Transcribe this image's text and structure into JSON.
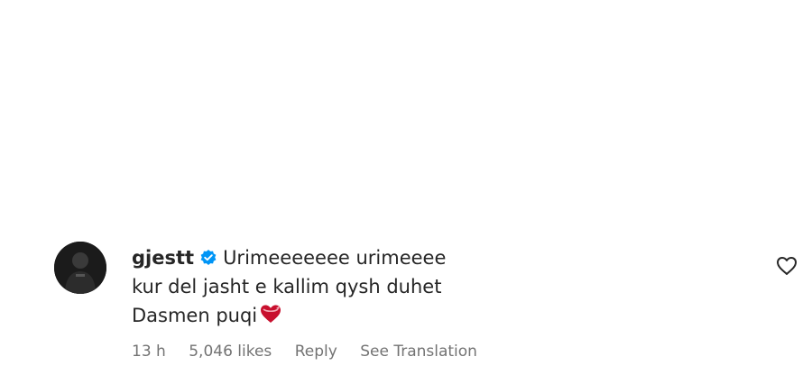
{
  "comment": {
    "username": "gjestt",
    "text_line1": "Urimeeeeeee urimeeee",
    "text_line2": "kur del jasht e kallim qysh duhet",
    "text_line3": "Dasmen puqi",
    "emoji": "heart-with-ribbon",
    "time_ago": "13 h",
    "likes": "5,046 likes",
    "reply_label": "Reply",
    "translation_label": "See Translation",
    "verified": true
  },
  "colors": {
    "text": "#262626",
    "meta": "#737373",
    "verified_badge": "#0095f6",
    "emoji_heart": "#c8102e"
  },
  "icons": {
    "like": "heart-outline-icon",
    "verified": "verified-badge-icon"
  }
}
